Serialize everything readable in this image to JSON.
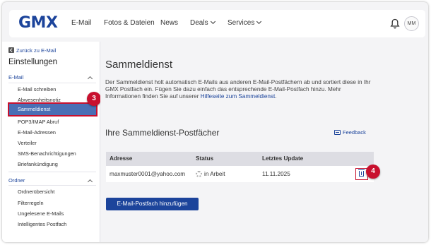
{
  "header": {
    "logo": "GMX",
    "nav": [
      {
        "label": "E-Mail"
      },
      {
        "label": "Fotos & Dateien"
      },
      {
        "label": "News"
      },
      {
        "label": "Deals"
      },
      {
        "label": "Services"
      }
    ],
    "avatar_initials": "MM",
    "icons": [
      "bell-icon",
      "chevron-down-icon"
    ]
  },
  "sidebar": {
    "back_label": "Zurück zu E-Mail",
    "title": "Einstellungen",
    "sections": [
      {
        "label": "E-Mail",
        "items": [
          {
            "label": "E-Mail schreiben"
          },
          {
            "label": "Abwesenheitsnotiz"
          },
          {
            "label": "Sammeldienst",
            "active": true
          },
          {
            "label": "POP3/IMAP Abruf"
          },
          {
            "label": "E-Mail-Adressen"
          },
          {
            "label": "Verteiler"
          },
          {
            "label": "SMS-Benachrichtigungen"
          },
          {
            "label": "Briefankündigung"
          }
        ]
      },
      {
        "label": "Ordner",
        "items": [
          {
            "label": "Ordnerübersicht"
          },
          {
            "label": "Filterregeln"
          },
          {
            "label": "Ungelesene E-Mails"
          },
          {
            "label": "Intelligentes Postfach"
          }
        ]
      }
    ]
  },
  "main": {
    "title": "Sammeldienst",
    "description": "Der Sammeldienst holt automatisch E-Mails aus anderen E-Mail-Postfächern ab und sortiert diese in Ihr GMX Postfach ein. Fügen Sie dazu einfach das entsprechende E-Mail-Postfach hinzu. Mehr Informationen finden Sie auf unserer ",
    "help_link": "Hilfeseite zum Sammeldienst",
    "description_end": ".",
    "subtitle": "Ihre Sammeldienst-Postfächer",
    "feedback_label": "Feedback",
    "table": {
      "headers": [
        "Adresse",
        "Status",
        "Letztes Update"
      ],
      "rows": [
        {
          "address": "maxmuster0001@yahoo.com",
          "status": "in Arbeit",
          "updated": "11.11.2025"
        }
      ]
    },
    "add_button": "E-Mail-Postfach hinzufügen"
  },
  "callouts": [
    "3",
    "4"
  ],
  "colors": {
    "brand": "#1c449b",
    "active_item": "#4a6fb5",
    "highlight": "#c8102e",
    "background": "#f4f4f6"
  }
}
